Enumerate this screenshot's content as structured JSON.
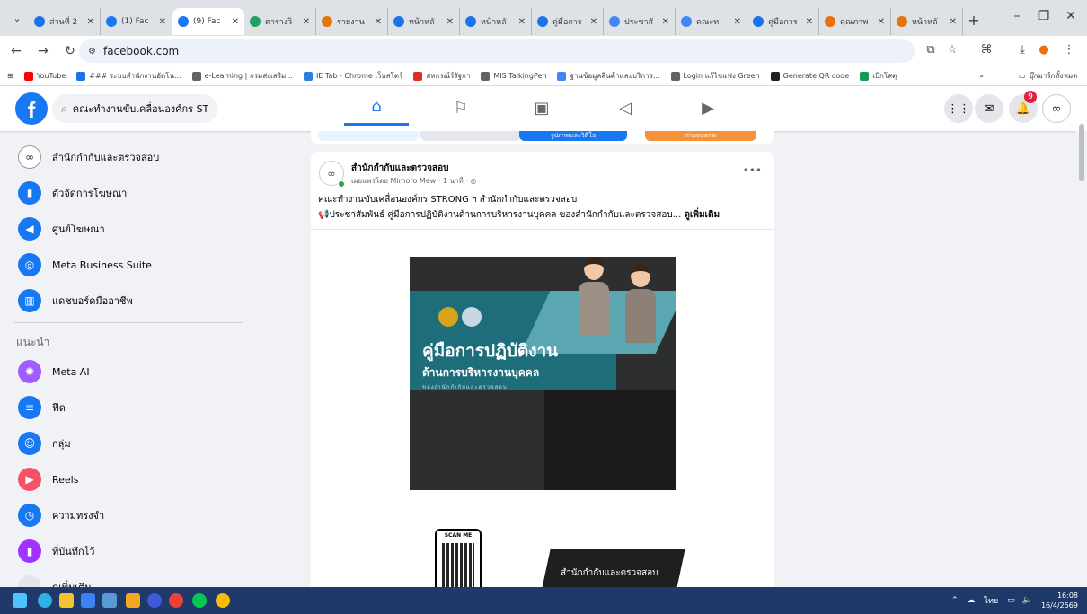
{
  "tabs": [
    {
      "title": "ส่วนที่ 2",
      "color": "#1a73e8"
    },
    {
      "title": "(1) Fac",
      "color": "#1877f2"
    },
    {
      "title": "(9) Fac",
      "color": "#1877f2"
    },
    {
      "title": "ตารางวิ",
      "color": "#1ea362"
    },
    {
      "title": "รายงาน",
      "color": "#e8710a"
    },
    {
      "title": "หน้าหลั",
      "color": "#1a73e8"
    },
    {
      "title": "หน้าหลั",
      "color": "#1a73e8"
    },
    {
      "title": "คู่มือการ",
      "color": "#1a73e8"
    },
    {
      "title": "ประชาสั",
      "color": "#4285f4"
    },
    {
      "title": "คณะท",
      "color": "#4285f4"
    },
    {
      "title": "คู่มือการ",
      "color": "#1a73e8"
    },
    {
      "title": "คุณภาพ",
      "color": "#e8710a"
    },
    {
      "title": "หน้าหลั",
      "color": "#e8710a"
    }
  ],
  "active_tab_index": 2,
  "address": {
    "site_icon": "tune-icon",
    "url": "facebook.com"
  },
  "bookmarks": [
    {
      "label": "YouTube",
      "color": "#ff0000"
    },
    {
      "label": "### ระบบสำนักงานอัตโน...",
      "color": "#1a73e8"
    },
    {
      "label": "e-Learning | กรมส่งเสริม...",
      "color": "#5f6368"
    },
    {
      "label": "IE Tab - Chrome เว็บสโตร์",
      "color": "#2a7de1"
    },
    {
      "label": "สหกรณ์ร์รัฐกา",
      "color": "#d93025"
    },
    {
      "label": "MIS TalkingPen",
      "color": "#5f6368"
    },
    {
      "label": "ฐานข้อมูลสินค้าและบริการ...",
      "color": "#4285f4"
    },
    {
      "label": "Login แก้ไขแฟง Green",
      "color": "#5f6368"
    },
    {
      "label": "Generate QR code",
      "color": "#202124"
    },
    {
      "label": "เบิกโสตุ",
      "color": "#0f9d58"
    }
  ],
  "bookmarks_overflow": "»",
  "bookmarks_folder": "บุ๊กมาร์กทั้งหมด",
  "search": {
    "value": "คณะทำงานขับเคลื่อนองค์กร ST"
  },
  "notif_count": "9",
  "sidebar": {
    "items": [
      {
        "label": "สำนักกำกับและตรวจสอบ",
        "icon": "page-avatar-icon",
        "color": "#ffffff"
      },
      {
        "label": "ตัวจัดการโฆษณา",
        "icon": "bar-chart-icon",
        "color": "#1877f2"
      },
      {
        "label": "ศูนย์โฆษณา",
        "icon": "megaphone-icon",
        "color": "#1877f2"
      },
      {
        "label": "Meta Business Suite",
        "icon": "meta-business-icon",
        "color": "#1877f2"
      },
      {
        "label": "แดชบอร์ดมืออาชีพ",
        "icon": "dashboard-icon",
        "color": "#1877f2"
      }
    ],
    "suggest_header": "แนะนำ",
    "suggest_items": [
      {
        "label": "Meta AI",
        "icon": "meta-ai-icon",
        "color": "#a05cff"
      },
      {
        "label": "ฟีด",
        "icon": "feed-icon",
        "color": "#1877f2"
      },
      {
        "label": "กลุ่ม",
        "icon": "groups-icon",
        "color": "#1877f2"
      },
      {
        "label": "Reels",
        "icon": "reels-icon",
        "color": "#f35369"
      },
      {
        "label": "ความทรงจำ",
        "icon": "memories-icon",
        "color": "#1877f2"
      },
      {
        "label": "ที่บันทึกไว้",
        "icon": "saved-icon",
        "color": "#a033ff"
      },
      {
        "label": "ดูเพิ่มเติม",
        "icon": "chevron-down-icon",
        "color": "#e4e6eb"
      }
    ]
  },
  "stories": {
    "stub1": "รูปภาพและวิดีโอ",
    "stub2": "ถ่ายทอดสด"
  },
  "post": {
    "page_name": "สำนักกำกับและตรวจสอบ",
    "meta": "เผยแพร่โดย Mimoro Mew · 1 นาที ·",
    "line1": "คณะทำงานขับเคลื่อนองค์กร STRONG ฯ สำนักกำกับและตรวจสอบ",
    "line2": "📢ประชาสัมพันธ์ คู่มือการปฏิบัติงานด้านการบริหารงานบุคคล ของสำนักกำกับและตรวจสอบ...",
    "see_more": "ดูเพิ่มเติม",
    "poster": {
      "title": "คู่มือการปฏิบัติงาน",
      "subtitle": "ด้านการบริหารงานบุคคล",
      "small": "ของสำนักกำกับและตรวจสอบ",
      "scan_label": "SCAN ME",
      "banner_text": "สำนักกำกับและตรวจสอบ"
    }
  },
  "tray": {
    "lang": "ไทย",
    "time": "16:08",
    "date": "16/4/2569"
  }
}
